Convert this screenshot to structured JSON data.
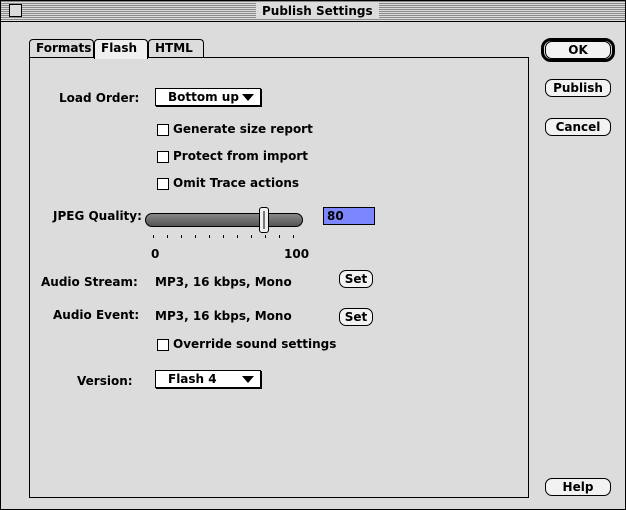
{
  "window": {
    "title": "Publish Settings"
  },
  "tabs": [
    {
      "label": "Formats"
    },
    {
      "label": "Flash"
    },
    {
      "label": "HTML"
    }
  ],
  "form": {
    "load_order": {
      "label": "Load Order:",
      "value": "Bottom up"
    },
    "options": {
      "generate_size_report": {
        "label": "Generate size report",
        "checked": false
      },
      "protect_from_import": {
        "label": "Protect from import",
        "checked": false
      },
      "omit_trace_actions": {
        "label": "Omit Trace actions",
        "checked": false
      }
    },
    "jpeg_quality": {
      "label": "JPEG Quality:",
      "value": "80",
      "min_label": "0",
      "max_label": "100",
      "value_number": 80
    },
    "audio_stream": {
      "label": "Audio Stream:",
      "value": "MP3, 16 kbps, Mono",
      "set_label": "Set"
    },
    "audio_event": {
      "label": "Audio Event:",
      "value": "MP3, 16 kbps, Mono",
      "set_label": "Set"
    },
    "override_sound": {
      "label": "Override sound settings",
      "checked": false
    },
    "version": {
      "label": "Version:",
      "value": "Flash 4"
    }
  },
  "buttons": {
    "ok": "OK",
    "publish": "Publish",
    "cancel": "Cancel",
    "help": "Help"
  }
}
